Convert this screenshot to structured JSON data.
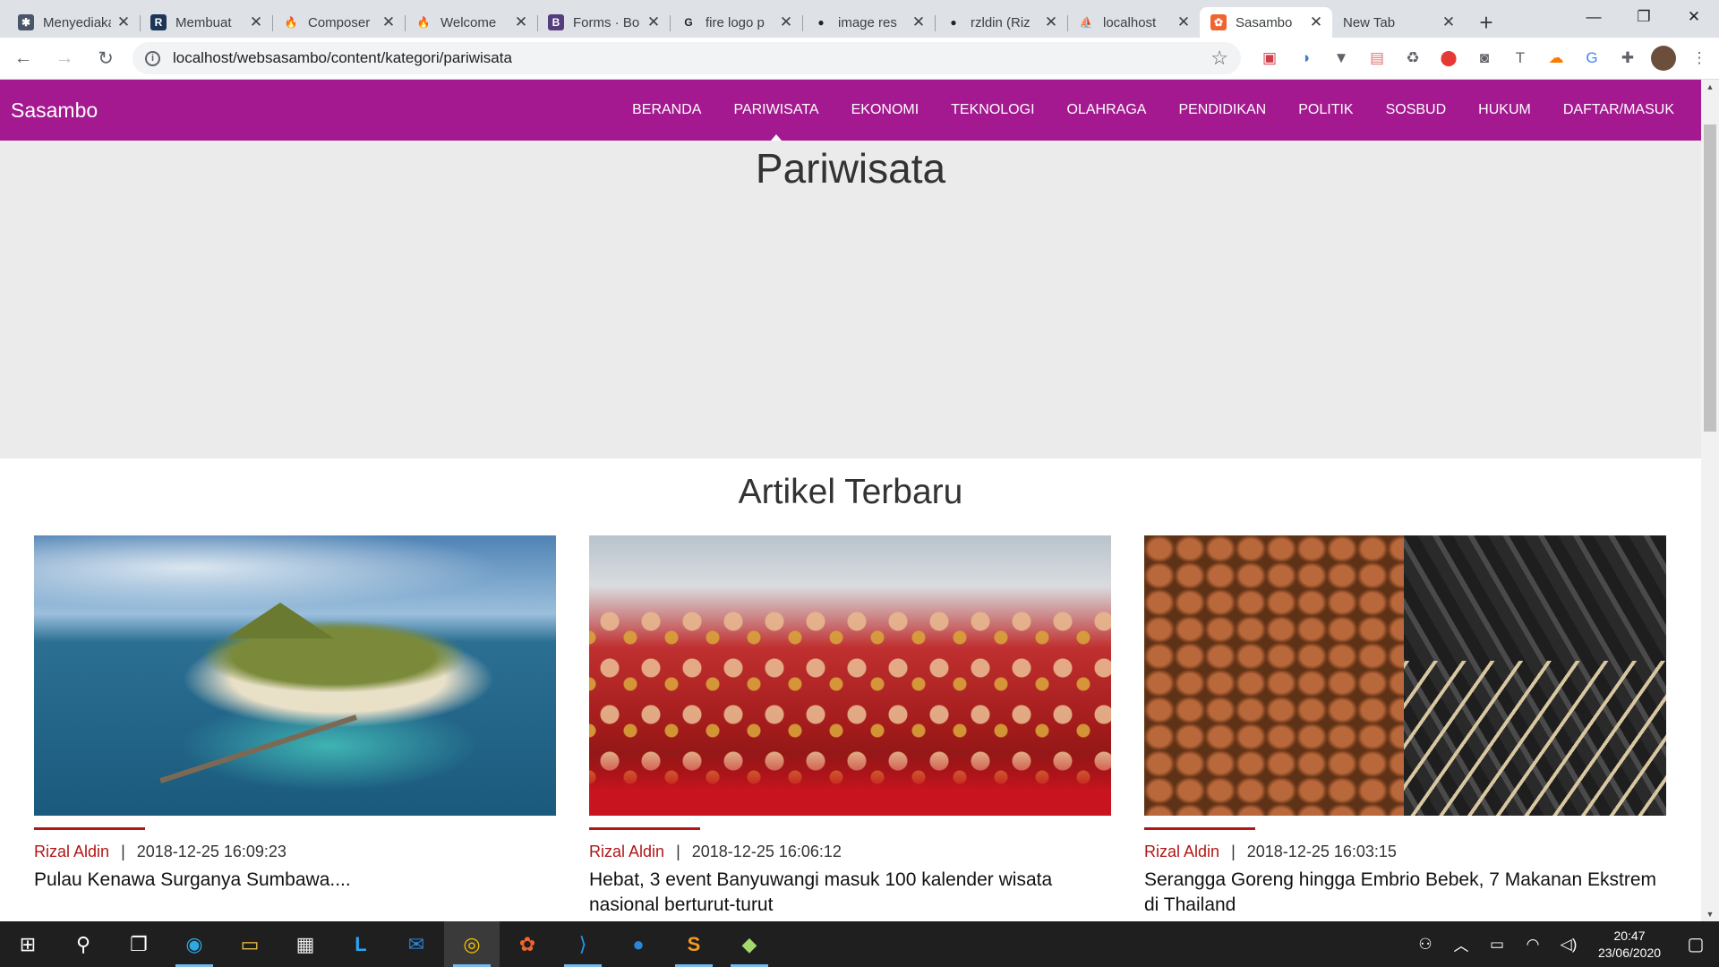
{
  "browser": {
    "tabs": [
      {
        "title": "Menyediakan",
        "icon": "stackedit-icon",
        "color": "#4a5568",
        "glyph": "✱",
        "active": false
      },
      {
        "title": "Membuat",
        "icon": "r-letter-icon",
        "color": "#1d3557",
        "glyph": "R",
        "active": false
      },
      {
        "title": "Composer",
        "icon": "fire-icon",
        "color": "#ffffff",
        "glyph": "🔥",
        "active": false
      },
      {
        "title": "Welcome",
        "icon": "fire-icon",
        "color": "#ffffff",
        "glyph": "🔥",
        "active": false
      },
      {
        "title": "Forms · Bo",
        "icon": "bootstrap-icon",
        "color": "#563d7c",
        "glyph": "B",
        "active": false
      },
      {
        "title": "fire logo p",
        "icon": "google-icon",
        "color": "#ffffff",
        "glyph": "G",
        "active": false
      },
      {
        "title": "image res",
        "icon": "github-icon",
        "color": "#ffffff",
        "glyph": "●",
        "active": false
      },
      {
        "title": "rzldin (Riz",
        "icon": "github-icon",
        "color": "#ffffff",
        "glyph": "●",
        "active": false
      },
      {
        "title": "localhost",
        "icon": "phpmyadmin-icon",
        "color": "#ffffff",
        "glyph": "⛵",
        "active": false
      },
      {
        "title": "Sasambo",
        "icon": "sasambo-icon",
        "color": "#f0642f",
        "glyph": "✿",
        "active": true
      },
      {
        "title": "New Tab",
        "icon": "",
        "color": "",
        "glyph": "",
        "active": false
      }
    ],
    "close_glyph": "✕",
    "new_tab_glyph": "+",
    "url": "localhost/websasambo/content/kategori/pariwisata",
    "window_controls": {
      "minimize": "—",
      "restore": "❐",
      "close": "✕"
    }
  },
  "site": {
    "brand": "Sasambo",
    "menu": [
      {
        "label": "BERANDA",
        "active": false
      },
      {
        "label": "PARIWISATA",
        "active": true
      },
      {
        "label": "EKONOMI",
        "active": false
      },
      {
        "label": "TEKNOLOGI",
        "active": false
      },
      {
        "label": "OLAHRAGA",
        "active": false
      },
      {
        "label": "PENDIDIKAN",
        "active": false
      },
      {
        "label": "POLITIK",
        "active": false
      },
      {
        "label": "SOSBUD",
        "active": false
      },
      {
        "label": "HUKUM",
        "active": false
      },
      {
        "label": "DAFTAR/MASUK",
        "active": false
      }
    ],
    "hero_title": "Pariwisata",
    "section_title": "Artikel Terbaru",
    "articles": [
      {
        "author": "Rizal Aldin",
        "sep": "|",
        "date": "2018-12-25 16:09:23",
        "title": "Pulau Kenawa Surganya Sumbawa....",
        "image": "island-photo"
      },
      {
        "author": "Rizal Aldin",
        "sep": "|",
        "date": "2018-12-25 16:06:12",
        "title": "Hebat, 3 event Banyuwangi masuk 100 kalender wisata nasional berturut-turut",
        "image": "festival-photo"
      },
      {
        "author": "Rizal Aldin",
        "sep": "|",
        "date": "2018-12-25 16:03:15",
        "title": "Serangga Goreng hingga Embrio Bebek, 7 Makanan Ekstrem di Thailand",
        "image": "fried-insects-photo"
      }
    ],
    "colors": {
      "navbar": "#a4198f",
      "accent": "#b01818",
      "hero_bg": "#ebebeb"
    }
  },
  "taskbar": {
    "time": "20:47",
    "date": "23/06/2020"
  }
}
